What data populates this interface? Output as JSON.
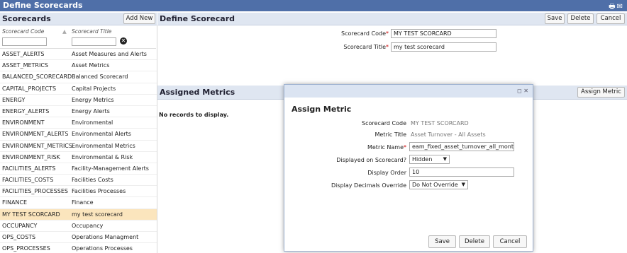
{
  "titlebar": {
    "title": "Define Scorecards",
    "icons": [
      "print-icon",
      "mail-icon"
    ]
  },
  "left": {
    "header": "Scorecards",
    "add_new": "Add New",
    "col_code": "Scorecard Code",
    "col_title": "Scorecard Title",
    "rows": [
      {
        "code": "ASSET_ALERTS",
        "title": "Asset Measures and Alerts"
      },
      {
        "code": "ASSET_METRICS",
        "title": "Asset Metrics"
      },
      {
        "code": "BALANCED_SCORECARD",
        "title": "Balanced Scorecard"
      },
      {
        "code": "CAPITAL_PROJECTS",
        "title": "Capital Projects"
      },
      {
        "code": "ENERGY",
        "title": "Energy Metrics"
      },
      {
        "code": "ENERGY_ALERTS",
        "title": "Energy Alerts"
      },
      {
        "code": "ENVIRONMENT",
        "title": "Environmental"
      },
      {
        "code": "ENVIRONMENT_ALERTS",
        "title": "Environmental Alerts"
      },
      {
        "code": "ENVIRONMENT_METRICS",
        "title": "Environmental Metrics"
      },
      {
        "code": "ENVIRONMENT_RISK",
        "title": "Environmental & Risk"
      },
      {
        "code": "FACILITIES_ALERTS",
        "title": "Facility-Management Alerts"
      },
      {
        "code": "FACILITIES_COSTS",
        "title": "Facilities Costs"
      },
      {
        "code": "FACILITIES_PROCESSES",
        "title": "Facilities Processes"
      },
      {
        "code": "FINANCE",
        "title": "Finance"
      },
      {
        "code": "MY TEST SCORCARD",
        "title": "my test scorecard",
        "selected": true
      },
      {
        "code": "OCCUPANCY",
        "title": "Occupancy"
      },
      {
        "code": "OPS_COSTS",
        "title": "Operations Managment"
      },
      {
        "code": "OPS_PROCESSES",
        "title": "Operations Processes"
      }
    ]
  },
  "define": {
    "header": "Define Scorecard",
    "save": "Save",
    "delete": "Delete",
    "cancel": "Cancel",
    "code_label": "Scorecard Code",
    "code_value": "MY TEST SCORCARD",
    "title_label": "Scorecard Title",
    "title_value": "my test scorecard",
    "req": "*"
  },
  "assigned": {
    "header": "Assigned Metrics",
    "assign_btn": "Assign Metric",
    "empty": "No records to display."
  },
  "dialog": {
    "title": "Assign Metric",
    "code_label": "Scorecard Code",
    "code_value": "MY TEST SCORCARD",
    "metric_title_label": "Metric Title",
    "metric_title_value": "Asset Turnover - All Assets",
    "metric_name_label": "Metric Name",
    "metric_name_value": "eam_fixed_asset_turnover_all_monthly",
    "displayed_label": "Displayed on Scorecard?",
    "displayed_value": "Hidden",
    "order_label": "Display Order",
    "order_value": "10",
    "decimals_label": "Display Decimals Override",
    "decimals_value": "Do Not Override",
    "save": "Save",
    "delete": "Delete",
    "cancel": "Cancel",
    "req": "*"
  }
}
